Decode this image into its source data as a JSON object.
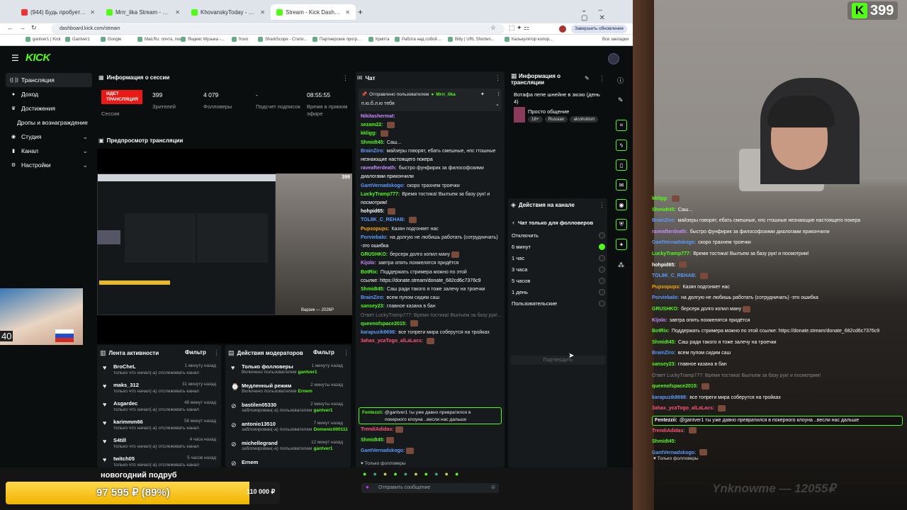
{
  "browser": {
    "tabs": [
      {
        "label": "(944) Будь пробуете КИТАЙС...",
        "color": "#e33"
      },
      {
        "label": "Mrrr_lika Stream - Watch Live o...",
        "color": "#53fc18"
      },
      {
        "label": "KhovanskyToday - Заказ подпи...",
        "color": "#53fc18"
      },
      {
        "label": "Stream - Kick Dashboard",
        "color": "#53fc18"
      }
    ],
    "url": "dashboard.kick.com/stream",
    "update_button": "Завершить обновление",
    "bookmarks": [
      "gantver1 | Kick",
      "Gantver1",
      "Google",
      "Mail.Ru: почта, пои...",
      "Яндекс Музыка -...",
      "frovo",
      "SharkScope - Стати...",
      "Партнерские прогр...",
      "Крипта",
      "Работа над собой ...",
      "Bitly | URL Shorten...",
      "Калькулятор колор..."
    ],
    "all_bookmarks": "Все закладки"
  },
  "sidebar": {
    "items": [
      {
        "label": "Трансляция",
        "icon": "broadcast-icon",
        "glyph": "((·))",
        "chev": ""
      },
      {
        "label": "Доход",
        "icon": "money-icon",
        "glyph": "●",
        "chev": ""
      },
      {
        "label": "Достижения",
        "icon": "trophy-icon",
        "glyph": "♛",
        "chev": ""
      },
      {
        "label": "Дропы и вознаграждение",
        "icon": "",
        "glyph": "",
        "chev": ""
      },
      {
        "label": "Студия",
        "icon": "studio-icon",
        "glyph": "◉",
        "chev": "⌄"
      },
      {
        "label": "Канал",
        "icon": "channel-icon",
        "glyph": "▮",
        "chev": "⌄"
      },
      {
        "label": "Настройки",
        "icon": "settings-icon",
        "glyph": "⚙",
        "chev": "⌄"
      }
    ]
  },
  "session": {
    "title": "Информация о сессии",
    "live_badge": "ИДЕТ ТРАНСЛЯЦИЯ",
    "live_label": "Сессия",
    "stats": [
      {
        "value": "399",
        "label": "Зрителей"
      },
      {
        "value": "4 079",
        "label": "Фолловеры"
      },
      {
        "value": "-",
        "label": "Подсчет подписок"
      },
      {
        "value": "08:55:55",
        "label": "Время в прямом эфире"
      }
    ]
  },
  "preview": {
    "title": "Предпросмотр трансляции",
    "inner_viewers": "399",
    "inner_caption": "Варзик — 2026Р"
  },
  "activity": {
    "title": "Лента активности",
    "filter": "Фильтр",
    "items": [
      {
        "user": "BroCheL",
        "text": "только что начал(-а) отслеживать канал",
        "time": "1 минуту назад"
      },
      {
        "user": "maks_312",
        "text": "только что начал(-а) отслеживать канал",
        "time": "31 минуту назад"
      },
      {
        "user": "Asgardec",
        "text": "только что начал(-а) отслеживать канал",
        "time": "48 минут назад"
      },
      {
        "user": "karimmm66",
        "text": "только что начал(-а) отслеживать канал",
        "time": "56 минут назад"
      },
      {
        "user": "S4till",
        "text": "только что начал(-а) отслеживать канал",
        "time": "4 часа назад"
      },
      {
        "user": "twitch05",
        "text": "только что начал(-а) отслеживать канал",
        "time": "5 часов назад"
      }
    ]
  },
  "modactions": {
    "title": "Действия модераторов",
    "filter": "Фильтр",
    "items": [
      {
        "user": "Только фолловеры",
        "text": "Включено пользователем",
        "by": "gantver1",
        "time": "1 минуту назад"
      },
      {
        "user": "Медленный режим",
        "text": "Включено пользователем",
        "by": "Ernem",
        "time": "2 минуты назад"
      },
      {
        "user": "bastilen05330",
        "text": "заблокирован(-а) пользователем",
        "by": "gantver1",
        "time": "2 минуты назад"
      },
      {
        "user": "antonio13510",
        "text": "заблокирован(-а) пользователем",
        "by": "Domenic000111",
        "time": "7 минут назад"
      },
      {
        "user": "michellegrand",
        "text": "заблокирован(-а) пользователем",
        "by": "gantver1",
        "time": "12 минут назад"
      },
      {
        "user": "Ernem",
        "text": "",
        "by": "",
        "time": ""
      }
    ]
  },
  "chat": {
    "title": "Чат",
    "pinned_by": "Отправлено пользователем",
    "pinned_user": "Mrrr_lika",
    "pinned_text": "п.ю.б.л.ю тебя",
    "messages": [
      {
        "user": "Nikitashermat:",
        "text": "",
        "color": "#cc88ff"
      },
      {
        "user": "sezam22:",
        "text": "",
        "color": "#53fc18",
        "emote": true
      },
      {
        "user": "kkligg:",
        "text": "",
        "color": "#53fc18",
        "emote": true
      },
      {
        "user": "Shmidt45:",
        "text": "Саш...",
        "color": "#53fc18"
      },
      {
        "user": "BrainZiro:",
        "text": "майзеры говорят, ебать смешные, нпс гтошные",
        "color": "#5c9cff"
      },
      {
        "user": "",
        "text": "незнающие настоящего покера",
        "color": "#fff"
      },
      {
        "user": "raveafterdeath:",
        "text": "быстро фунфирик за философскими",
        "color": "#c58dff"
      },
      {
        "user": "",
        "text": "диалогами прикончили",
        "color": "#fff"
      },
      {
        "user": "GantVernadskogo:",
        "text": "скоро трахнем троечки",
        "color": "#5c9cff"
      },
      {
        "user": "LuckyTramp777:",
        "text": "Время тостика! Вылъем за базу рук! и",
        "color": "#53fc18"
      },
      {
        "user": "",
        "text": "посмотрим!",
        "color": "#fff"
      },
      {
        "user": "hohpid65:",
        "text": "",
        "color": "#fff",
        "emote": true
      },
      {
        "user": "TOL8K_C_REHAB:",
        "text": "",
        "color": "#5c9cff",
        "emote": true
      },
      {
        "user": "Pupsopups:",
        "text": "Казян подгоняет нас",
        "color": "#ffa500"
      },
      {
        "user": "Porviebalo:",
        "text": "на долгую не любишь работать (сотрудничать)",
        "color": "#5c9cff"
      },
      {
        "user": "",
        "text": "-это ошибка",
        "color": "#fff"
      },
      {
        "user": "GRUSHKO:",
        "text": "берсерк долго копил ману",
        "color": "#53fc18",
        "emote": true
      },
      {
        "user": "Kijolo:",
        "text": "завтра опять похмелятся придётся",
        "color": "#c58dff"
      },
      {
        "user": "BotRix:",
        "text": "Поддержать стримера можно по этой",
        "color": "#53fc18"
      },
      {
        "user": "",
        "text": "ссылке: https://donate.stream/donate_682cd6c7376c9",
        "color": "#fff"
      },
      {
        "user": "Shmidt45:",
        "text": "Саш ради такого я тоже залечу на троечки",
        "color": "#53fc18"
      },
      {
        "user": "BrainZiro:",
        "text": "всем пупом сидим саш",
        "color": "#5c9cff"
      },
      {
        "user": "sansey23:",
        "text": "главное казана в бан",
        "color": "#53fc18"
      },
      {
        "user": "",
        "text": "Ответ LuckyTramp777: Время тостика! Вылъем за базу рук!...",
        "color": "#777"
      },
      {
        "user": "queenofspace2015:",
        "text": "",
        "color": "#53fc18",
        "emote": true
      },
      {
        "user": "karapuzik8698:",
        "text": "все топреги мира соберутся на тройках",
        "color": "#5c9cff"
      },
      {
        "user": "3ahax_ycaTogo_alLaLacs:",
        "text": "",
        "color": "#ff5577",
        "emote": true
      }
    ],
    "highlight": {
      "user": "Fentezzii:",
      "text": "@gantver1 ты уже давно превратился в",
      "text2": "покерного клоуна ..весли нас дальше"
    },
    "tail": [
      {
        "user": "TrendiAdidas:",
        "color": "#ff5577"
      },
      {
        "user": "Shmidt45:",
        "color": "#53fc18"
      },
      {
        "user": "GantVernadskogo:",
        "color": "#5c9cff"
      }
    ],
    "followers_only": "Только фолловеры",
    "input_placeholder": "Отправить сообщение"
  },
  "stream_info": {
    "title": "Информация о трансляции",
    "stream_title": "Вотафа пепе шнейне в зюзю (день 4)",
    "category": "Просто общение",
    "tags": [
      "18+",
      "Russian",
      "alcoholism"
    ]
  },
  "channel_actions": {
    "title": "Действия на канале",
    "sub_title": "Чат только для фолловеров",
    "options": [
      {
        "label": "Отключить",
        "on": false
      },
      {
        "label": "6 минут",
        "on": true
      },
      {
        "label": "1 час",
        "on": false
      },
      {
        "label": "3 часа",
        "on": false
      },
      {
        "label": "5 часов",
        "on": false
      },
      {
        "label": "1 день",
        "on": false
      },
      {
        "label": "Пользовательские",
        "on": false
      }
    ],
    "confirm": "Подтвердить"
  },
  "overlay": {
    "viewer_count": "399",
    "goal_title": "новогодний подруб",
    "goal_value": "97 595 ₽ (89%)",
    "goal_target": "110 000 ₽",
    "goal_fraction": 0.89,
    "bottom_ticker": "Ynknowme — 12055₽",
    "chat": [
      {
        "user": "kkligg:",
        "text": "",
        "color": "#53fc18",
        "emote": true
      },
      {
        "user": "Shmidt45:",
        "text": "Саш...",
        "color": "#53fc18"
      },
      {
        "user": "BrainZiro:",
        "text": "майзеры говорят, ебать смешные, нпс гтошные незнающие настоящего покера",
        "color": "#5c9cff"
      },
      {
        "user": "raveafterdeath:",
        "text": "быстро фунфирик за философскими диалогами прикончили",
        "color": "#c58dff"
      },
      {
        "user": "GantVernadskogo:",
        "text": "скоро трахнем троечки",
        "color": "#5c9cff"
      },
      {
        "user": "LuckyTramp777:",
        "text": "Время тостика! Вылъем за базу рук! и посмотрим!",
        "color": "#53fc18"
      },
      {
        "user": "hohpid65:",
        "text": "",
        "color": "#fff",
        "emote": true
      },
      {
        "user": "TOL8K_C_REHAB:",
        "text": "",
        "color": "#5c9cff",
        "emote": true
      },
      {
        "user": "Pupsopups:",
        "text": "Казян подгоняет нас",
        "color": "#ffa500"
      },
      {
        "user": "Porviebalo:",
        "text": "на долгую не любишь работать (сотрудничать) -это ошибка",
        "color": "#5c9cff"
      },
      {
        "user": "GRUSHKO:",
        "text": "берсерк долго копил ману",
        "color": "#53fc18",
        "emote": true
      },
      {
        "user": "Kijolo:",
        "text": "завтра опять похмелятся придётся",
        "color": "#c58dff"
      },
      {
        "user": "BotRix:",
        "text": "Поддержать стримера можно по этой ссылке: https://donate.stream/donate_682cd6c7376c9",
        "color": "#53fc18"
      },
      {
        "user": "Shmidt45:",
        "text": "Саш ради такого я тоже залечу на троечки",
        "color": "#53fc18"
      },
      {
        "user": "BrainZiro:",
        "text": "всем пупом сидим саш",
        "color": "#5c9cff"
      },
      {
        "user": "sansey23:",
        "text": "главное казана в бан",
        "color": "#53fc18"
      },
      {
        "user": "",
        "text": "Ответ LuckyTramp777: Время тостика! Вылъем за базу рук! и посмотрим!",
        "color": "#888"
      },
      {
        "user": "queenofspace2015:",
        "text": "",
        "color": "#53fc18",
        "emote": true
      },
      {
        "user": "karapuzik8698:",
        "text": "все топреги мира соберутся на тройках",
        "color": "#5c9cff"
      },
      {
        "user": "3ahax_ycaTogo_alLaLacs:",
        "text": "",
        "color": "#ff5577",
        "emote": true
      },
      {
        "user": "Fentezzii:",
        "text": "@gantver1 ты уже давно превратился в покерного клоуна ..весли нас дальше",
        "color": "#fff",
        "hl": true
      },
      {
        "user": "TrendiAdidas:",
        "text": "",
        "color": "#ff5577",
        "emote": true
      },
      {
        "user": "Shmidt45:",
        "text": "",
        "color": "#53fc18"
      },
      {
        "user": "GantVernadskogo:",
        "text": "",
        "color": "#5c9cff",
        "emote": true
      }
    ],
    "followers_only": "Только фолловеры"
  }
}
